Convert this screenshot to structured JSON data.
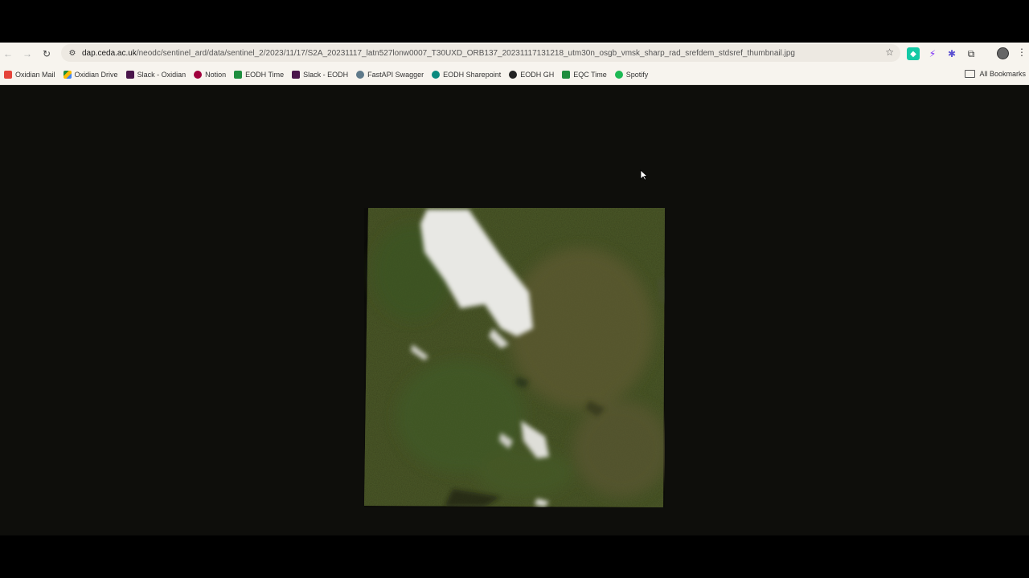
{
  "toolbar": {
    "url_host": "dap.ceda.ac.uk",
    "url_path": "/neodc/sentinel_ard/data/sentinel_2/2023/11/17/S2A_20231117_latn527lonw0007_T30UXD_ORB137_20231117131218_utm30n_osgb_vmsk_sharp_rad_srefdem_stdsref_thumbnail.jpg",
    "back_icon": "←",
    "forward_icon": "→",
    "reload_icon": "↻",
    "site_info_icon": "⚙",
    "star_icon": "☆",
    "menu_icon": "⋮"
  },
  "extensions": [
    {
      "name": "teal-extension-icon",
      "glyph": "◆"
    },
    {
      "name": "lightning-extension-icon",
      "glyph": "⚡"
    },
    {
      "name": "gear-extension-icon",
      "glyph": "✱"
    },
    {
      "name": "puzzle-extensions-icon",
      "glyph": "⧉"
    }
  ],
  "bookmarks": [
    {
      "label": "Oxidian Mail",
      "icon": "gmail"
    },
    {
      "label": "Oxidian Drive",
      "icon": "drive"
    },
    {
      "label": "Slack - Oxidian",
      "icon": "slack"
    },
    {
      "label": "Notion",
      "icon": "notion"
    },
    {
      "label": "EODH Time",
      "icon": "sheet"
    },
    {
      "label": "Slack - EODH",
      "icon": "slack"
    },
    {
      "label": "FastAPI Swagger",
      "icon": "swagger"
    },
    {
      "label": "EODH Sharepoint",
      "icon": "sharepoint"
    },
    {
      "label": "EODH GH",
      "icon": "github"
    },
    {
      "label": "EQC Time",
      "icon": "sheet"
    },
    {
      "label": "Spotify",
      "icon": "spotify"
    }
  ],
  "all_bookmarks_label": "All Bookmarks",
  "colors": {
    "chrome_bg": "#f7f4ee",
    "page_bg": "#0e0e0b",
    "omnibox_bg": "#ede9e2"
  }
}
